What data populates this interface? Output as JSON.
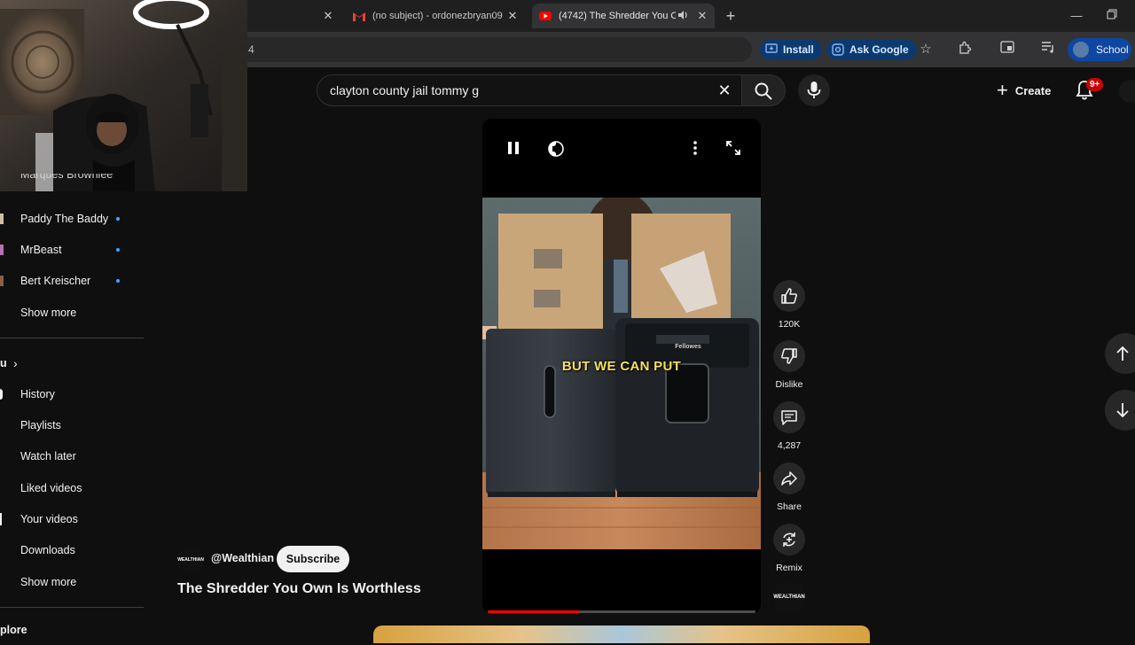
{
  "browser": {
    "tabs": [
      {
        "label": "(no subject) - ordonezbryan09",
        "favicon": "gmail-icon",
        "active": false
      },
      {
        "label": "(4742) The Shredder You O",
        "favicon": "youtube-icon",
        "active": true
      }
    ],
    "omnibox_fragment": "4",
    "install_label": "Install",
    "ask_google_label": "Ask Google",
    "profile_label": "School"
  },
  "youtube": {
    "search_query": "clayton county jail tommy g",
    "create_label": "Create",
    "notification_badge": "9+"
  },
  "sidebar": {
    "partial_top": "Marques Brownlee",
    "subscriptions": [
      {
        "label": "Paddy The Baddy",
        "new": true
      },
      {
        "label": "MrBeast",
        "new": true
      },
      {
        "label": "Bert Kreischer",
        "new": true
      }
    ],
    "show_more_1": "Show more",
    "you_header": "u",
    "you_items": [
      "History",
      "Playlists",
      "Watch later",
      "Liked videos",
      "Your videos",
      "Downloads"
    ],
    "show_more_2": "Show more",
    "explore_header": "plore"
  },
  "player": {
    "caption": "BUT WE CAN PUT",
    "progress": 0.34
  },
  "actions": {
    "like_count": "120K",
    "dislike_label": "Dislike",
    "comment_count": "4,287",
    "share_label": "Share",
    "remix_label": "Remix"
  },
  "video": {
    "channel_handle": "@Wealthian",
    "channel_avatar_text": "WEALTHIAN",
    "subscribe_label": "Subscribe",
    "title": "The Shredder You Own Is Worthless"
  },
  "colors": {
    "accent_red": "#ff0000",
    "badge_red": "#cc0000",
    "link_blue": "#3ea6ff",
    "caption_yellow": "#f6e15a"
  }
}
